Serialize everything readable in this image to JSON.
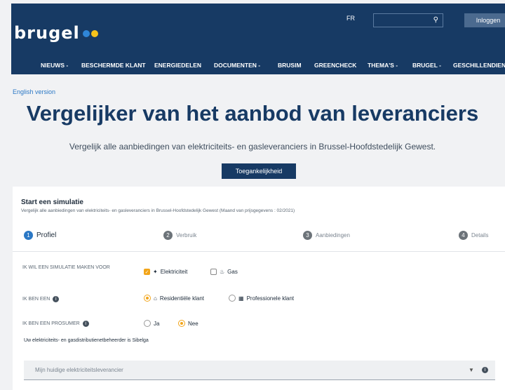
{
  "header": {
    "logo_text": "brugel",
    "logo_dot_colors": [
      "#2f86d8",
      "#f5c21b"
    ],
    "lang_label": "FR",
    "search_icon": "search-icon",
    "login_label": "Inloggen"
  },
  "nav": {
    "items": [
      "NIEUWS -",
      "BESCHERMDE KLANT",
      "ENERGIEDELEN",
      "DOCUMENTEN -",
      "BRUSIM",
      "GREENCHECK",
      "THEMA'S -",
      "BRUGEL -",
      "GESCHILLENDIENST"
    ]
  },
  "page": {
    "english_link": "English version",
    "title": "Vergelijker van het aanbod van leveranciers",
    "subtitle": "Vergelijk alle aanbiedingen van elektriciteits- en gasleveranciers in Brussel-Hoofdstedelijk Gewest.",
    "cta_label": "Toegankelijkheid"
  },
  "simulation": {
    "title": "Start een simulatie",
    "description": "Vergelijk alle aanbiedingen van elektriciteits- en gasleveranciers in Brussel-Hoofdstedelijk Gewest (Maand van prijsgegevens : 02/2021)",
    "steps": [
      {
        "num": "1",
        "label": "Profiel"
      },
      {
        "num": "2",
        "label": "Verbruik"
      },
      {
        "num": "3",
        "label": "Aanbiedingen"
      },
      {
        "num": "4",
        "label": "Details"
      }
    ],
    "fields": {
      "simulation_for": {
        "label": "IK WIL EEN SIMULATIE MAKEN VOOR",
        "options": [
          "Elektriciteit",
          "Gas"
        ]
      },
      "i_am": {
        "label": "IK BEN EEN",
        "options": [
          "Residentiële klant",
          "Professionele klant"
        ]
      },
      "prosumer": {
        "label": "IK BEN EEN PROSUMER",
        "options": [
          "Ja",
          "Nee"
        ]
      }
    },
    "note": "Uw elektriciteits- en gasdistributienetbeheerder is Sibelga",
    "supplier_select": {
      "placeholder": "Mijn huidige elektriciteitsleverancier"
    }
  },
  "colors": {
    "brand_navy": "#173a64",
    "accent_orange": "#f2a51a",
    "accent_blue": "#2b78c5"
  }
}
